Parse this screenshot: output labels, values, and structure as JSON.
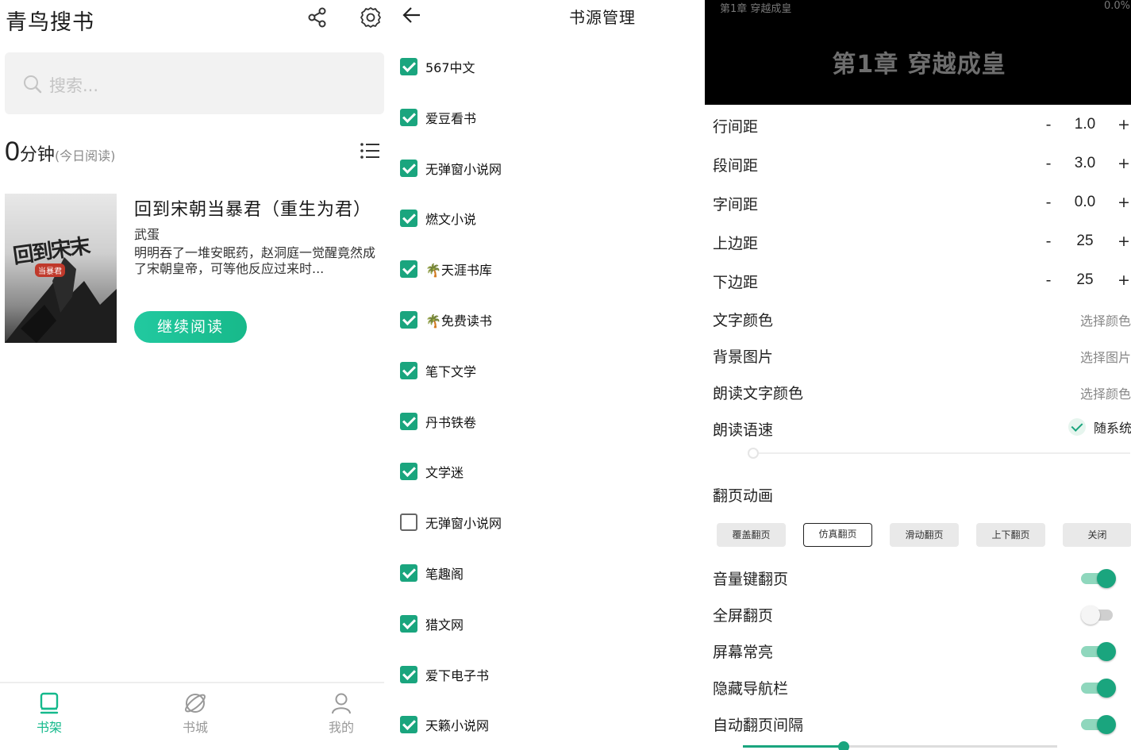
{
  "shelf": {
    "app_title": "青鸟搜书",
    "share_icon": "share-icon",
    "settings_icon": "gear-icon",
    "search_placeholder": "搜索...",
    "read_time_value": "0",
    "read_time_unit": "分钟",
    "read_time_sub": "(今日阅读)",
    "book": {
      "cover_title": "回到宋末",
      "cover_sub": "当暴君",
      "title": "回到宋朝当暴君（重生为君）",
      "author": "武蛋",
      "description": "明明吞了一堆安眠药，赵洞庭一觉醒竟然成了宋朝皇帝，可等他反应过来时...",
      "continue_label": "继续阅读"
    },
    "nav": [
      {
        "label": "书架",
        "icon": "bookshelf-icon",
        "active": true
      },
      {
        "label": "书城",
        "icon": "planet-icon",
        "active": false
      },
      {
        "label": "我的",
        "icon": "user-icon",
        "active": false
      }
    ]
  },
  "sources": {
    "title": "书源管理",
    "items": [
      {
        "label": "567中文",
        "checked": true
      },
      {
        "label": "爱豆看书",
        "checked": true
      },
      {
        "label": "无弹窗小说网",
        "checked": true
      },
      {
        "label": "燃文小说",
        "checked": true
      },
      {
        "label": "🌴天涯书库",
        "checked": true
      },
      {
        "label": "🌴免费读书",
        "checked": true
      },
      {
        "label": "笔下文学",
        "checked": true
      },
      {
        "label": "丹书铁卷",
        "checked": true
      },
      {
        "label": "文学迷",
        "checked": true
      },
      {
        "label": "无弹窗小说网",
        "checked": false
      },
      {
        "label": "笔趣阁",
        "checked": true
      },
      {
        "label": "猎文网",
        "checked": true
      },
      {
        "label": "爱下电子书",
        "checked": true
      },
      {
        "label": "天籁小说网",
        "checked": true
      }
    ]
  },
  "reader": {
    "preview_chapter_small": "第1章 穿越成皇",
    "preview_progress": "0.0%",
    "preview_title": "第1章 穿越成皇",
    "steppers": [
      {
        "label": "行间距",
        "minus": "-",
        "value": "1.0",
        "plus": "+"
      },
      {
        "label": "段间距",
        "minus": "-",
        "value": "3.0",
        "plus": "+"
      },
      {
        "label": "字间距",
        "minus": "-",
        "value": "0.0",
        "plus": "+"
      },
      {
        "label": "上边距",
        "minus": "-",
        "value": "25",
        "plus": "+"
      },
      {
        "label": "下边距",
        "minus": "-",
        "value": "25",
        "plus": "+"
      }
    ],
    "pickers": [
      {
        "label": "文字颜色",
        "action": "选择颜色"
      },
      {
        "label": "背景图片",
        "action": "选择图片"
      },
      {
        "label": "朗读文字颜色",
        "action": "选择颜色"
      }
    ],
    "speech_rate_label": "朗读语速",
    "speech_follow_label": "随系统",
    "speech_rate_level": 0.0,
    "page_anim_label": "翻页动画",
    "page_anim_options": [
      "覆盖翻页",
      "仿真翻页",
      "滑动翻页",
      "上下翻页",
      "关闭"
    ],
    "page_anim_selected": "仿真翻页",
    "toggles": [
      {
        "label": "音量键翻页",
        "on": true
      },
      {
        "label": "全屏翻页",
        "on": false
      },
      {
        "label": "屏幕常亮",
        "on": true
      },
      {
        "label": "隐藏导航栏",
        "on": true
      },
      {
        "label": "自动翻页间隔",
        "on": true
      }
    ],
    "auto_interval_level": 0.32,
    "accent_color": "#1aa57e"
  }
}
